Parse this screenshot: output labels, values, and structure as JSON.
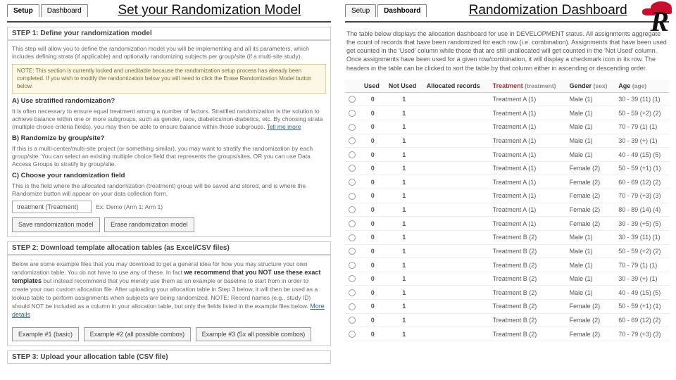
{
  "left": {
    "tabs": {
      "setup": "Setup",
      "dashboard": "Dashboard"
    },
    "title": "Set your Randomization Model",
    "step1": {
      "head": "STEP 1: Define your randomization model",
      "intro": "This step will allow you to define the randomization model you will be implementing and all its parameters, which includes defining strata (if applicable) and optionally randomizing subjects per group/site (if a multi-site study).",
      "note": "NOTE: This section is currently locked and uneditable because the randomization setup process has already been completed. If you wish to modify the randomization below you will need to click the Erase Randomization Model button below.",
      "a_head": "A) Use stratified randomization?",
      "a_text": "It is often necessary to ensure equal treatment among a number of factors. Stratified randomization is the solution to achieve balance within one or more subgroups, such as gender, race, diabetics/non-diabetics, etc. By choosing strata (multiple choice criteria fields), you may then be able to ensure balance within those subgroups.",
      "a_link": "Tell me more",
      "b_head": "B) Randomize by group/site?",
      "b_text": "If this is a multi-center/multi-site project (or something similar), you may want to stratify the randomization by each group/site. You can select an existing multiple choice field that represents the groups/sites, OR you can use Data Access Groups to stratify by group/site.",
      "c_head": "C) Choose your randomization field",
      "c_text": "This is the field where the allocated randomization (treatment) group will be saved and stored, and is where the Randomize button will appear on your data collection form.",
      "select_label": "treatment (Treatment)",
      "select_form": "Ex: Demo (Arm 1: Arm 1)",
      "btn_save": "Save randomization model",
      "btn_erase": "Erase randomization model"
    },
    "step2": {
      "head": "STEP 2: Download template allocation tables (as Excel/CSV files)",
      "text1": "Below are some example files that you may download to get a general idea for how you may structure your own randomization table. You do not have to use any of these. In fact ",
      "bold": "we recommend that you NOT use these exact templates",
      "text2": " but instead recommend that you merely use them as an example or baseline to start from in order to create your own custom allocation file. After uploading your allocation table in Step 3 below, it will then be used as a lookup table to perform assignments when subjects are being randomized. NOTE: Record names (e.g., study ID) should NOT be included as a column in your allocation table, but only the fields listed in the example files below. ",
      "more": "More details",
      "ex1": "Example #1 (basic)",
      "ex2": "Example #2 (all possible combos)",
      "ex3": "Example #3 (5x all possible combos)"
    },
    "step3": {
      "head": "STEP 3: Upload your allocation table (CSV file)"
    }
  },
  "right": {
    "tabs": {
      "setup": "Setup",
      "dashboard": "Dashboard"
    },
    "title": "Randomization Dashboard",
    "desc": "The table below displays the allocation dashboard for use in DEVELOPMENT status. All assignments aggregate the count of records that have been randomized for each row (i.e. combination). Assignments that have been used get counted in the 'Used' column while those that are still unallocated will get counted in the 'Not Used' column. Once assignments have been used for a given row/combination, it will display a checkmark icon in its row. The headers in the table can be clicked to sort the table by that column either in ascending or descending order.",
    "headers": {
      "blank": "",
      "used": "Used",
      "notused": "Not Used",
      "allocated": "Allocated records",
      "treatment": "Treatment",
      "treatment_code": "(treatment)",
      "gender": "Gender",
      "gender_code": "(sex)",
      "age": "Age",
      "age_code": "(age)"
    },
    "rows": [
      {
        "u": "0",
        "n": "1",
        "t": "Treatment A (1)",
        "g": "Male (1)",
        "a": "30 - 39 (11) (1)"
      },
      {
        "u": "0",
        "n": "1",
        "t": "Treatment A (1)",
        "g": "Male (1)",
        "a": "50 - 59 (+2) (2)"
      },
      {
        "u": "0",
        "n": "1",
        "t": "Treatment A (1)",
        "g": "Male (1)",
        "a": "70 - 79 (1) (1)"
      },
      {
        "u": "0",
        "n": "1",
        "t": "Treatment A (1)",
        "g": "Male (1)",
        "a": "30 - 39 (+) (1)"
      },
      {
        "u": "0",
        "n": "1",
        "t": "Treatment A (1)",
        "g": "Male (1)",
        "a": "40 - 49 (15) (5)"
      },
      {
        "u": "0",
        "n": "1",
        "t": "Treatment A (1)",
        "g": "Female (2)",
        "a": "50 - 59 (+1) (1)"
      },
      {
        "u": "0",
        "n": "1",
        "t": "Treatment A (1)",
        "g": "Female (2)",
        "a": "60 - 69 (12) (2)"
      },
      {
        "u": "0",
        "n": "1",
        "t": "Treatment A (1)",
        "g": "Female (2)",
        "a": "70 - 79 (+3) (3)"
      },
      {
        "u": "0",
        "n": "1",
        "t": "Treatment A (1)",
        "g": "Female (2)",
        "a": "80 - 89 (14) (4)"
      },
      {
        "u": "0",
        "n": "1",
        "t": "Treatment A (1)",
        "g": "Female (2)",
        "a": "30 - 39 (+5) (5)"
      },
      {
        "u": "0",
        "n": "1",
        "t": "Treatment B (2)",
        "g": "Male (1)",
        "a": "30 - 39 (11) (1)"
      },
      {
        "u": "0",
        "n": "1",
        "t": "Treatment B (2)",
        "g": "Male (1)",
        "a": "50 - 59 (+2) (2)"
      },
      {
        "u": "0",
        "n": "1",
        "t": "Treatment B (2)",
        "g": "Male (1)",
        "a": "70 - 79 (1) (1)"
      },
      {
        "u": "0",
        "n": "1",
        "t": "Treatment B (2)",
        "g": "Male (1)",
        "a": "30 - 39 (+) (1)"
      },
      {
        "u": "0",
        "n": "1",
        "t": "Treatment B (2)",
        "g": "Male (1)",
        "a": "40 - 49 (15) (5)"
      },
      {
        "u": "0",
        "n": "1",
        "t": "Treatment B (2)",
        "g": "Female (2)",
        "a": "50 - 59 (+1) (1)"
      },
      {
        "u": "0",
        "n": "1",
        "t": "Treatment B (2)",
        "g": "Female (2)",
        "a": "60 - 69 (12) (2)"
      },
      {
        "u": "0",
        "n": "1",
        "t": "Treatment B (2)",
        "g": "Female (2)",
        "a": "70 - 79 (+3) (3)"
      }
    ]
  }
}
